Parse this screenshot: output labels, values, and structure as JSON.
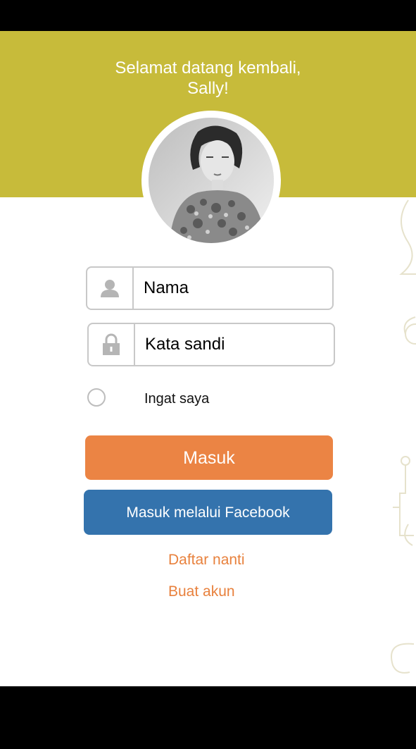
{
  "header": {
    "welcome_line1": "Selamat datang kembali,",
    "welcome_line2": "Sally!",
    "background_color": "#c7bb3a"
  },
  "avatar": {
    "icon": "user-photo"
  },
  "form": {
    "name_field": {
      "placeholder": "Nama",
      "value": "",
      "icon": "person-icon"
    },
    "password_field": {
      "placeholder": "Kata sandi",
      "value": "",
      "icon": "lock-icon"
    },
    "remember_me": {
      "label": "Ingat saya",
      "checked": false
    }
  },
  "buttons": {
    "login_label": "Masuk",
    "login_color": "#eb8444",
    "facebook_label": "Masuk melalui Facebook",
    "facebook_color": "#3473ad"
  },
  "links": {
    "register_later": "Daftar nanti",
    "create_account": "Buat akun",
    "link_color": "#e8813d"
  }
}
